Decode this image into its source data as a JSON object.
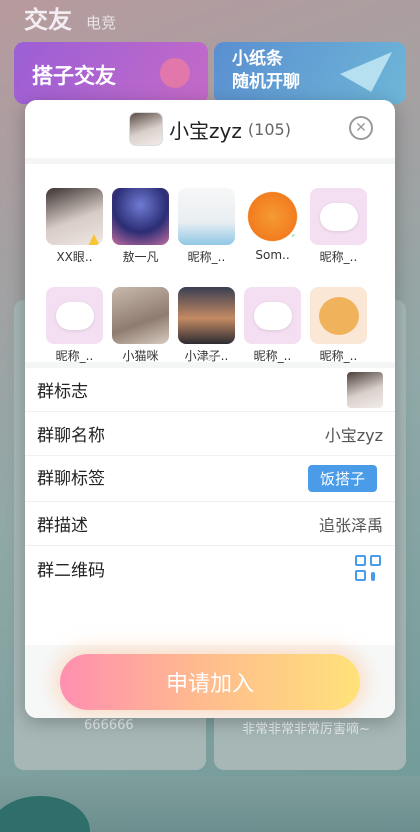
{
  "background": {
    "title": "交友",
    "subtitle": "电竞",
    "banner_left": "搭子交友",
    "banner_right_line1": "小纸条",
    "banner_right_line2": "随机开聊",
    "card_left_text": "666666",
    "card_right_text": "非常非常非常厉害嘀~"
  },
  "modal": {
    "group_name": "小宝zyz",
    "member_count": "(105)",
    "members": [
      {
        "name": "XX眼..",
        "avatar": "girl-photo"
      },
      {
        "name": "敖一凡",
        "avatar": "starry-sky"
      },
      {
        "name": "昵称_..",
        "avatar": "sunglasses-boy"
      },
      {
        "name": "Som..",
        "avatar": "orange-emoji"
      },
      {
        "name": "昵称_..",
        "avatar": "pink-cloud"
      },
      {
        "name": "昵称_..",
        "avatar": "pink-cloud"
      },
      {
        "name": "小猫咪",
        "avatar": "cat"
      },
      {
        "name": "小津子..",
        "avatar": "sunset-girl"
      },
      {
        "name": "昵称_..",
        "avatar": "cloud-sheep"
      },
      {
        "name": "昵称_..",
        "avatar": "bear"
      }
    ],
    "info": {
      "logo_label": "群标志",
      "name_label": "群聊名称",
      "name_value": "小宝zyz",
      "tag_label": "群聊标签",
      "tag_value": "饭搭子",
      "desc_label": "群描述",
      "desc_value": "追张泽禹",
      "qr_label": "群二维码"
    },
    "apply_label": "申请加入"
  },
  "colors": {
    "accent": "#4a9be8",
    "apply_gradient_start": "#ff8fb0",
    "apply_gradient_end": "#ffe27a"
  }
}
